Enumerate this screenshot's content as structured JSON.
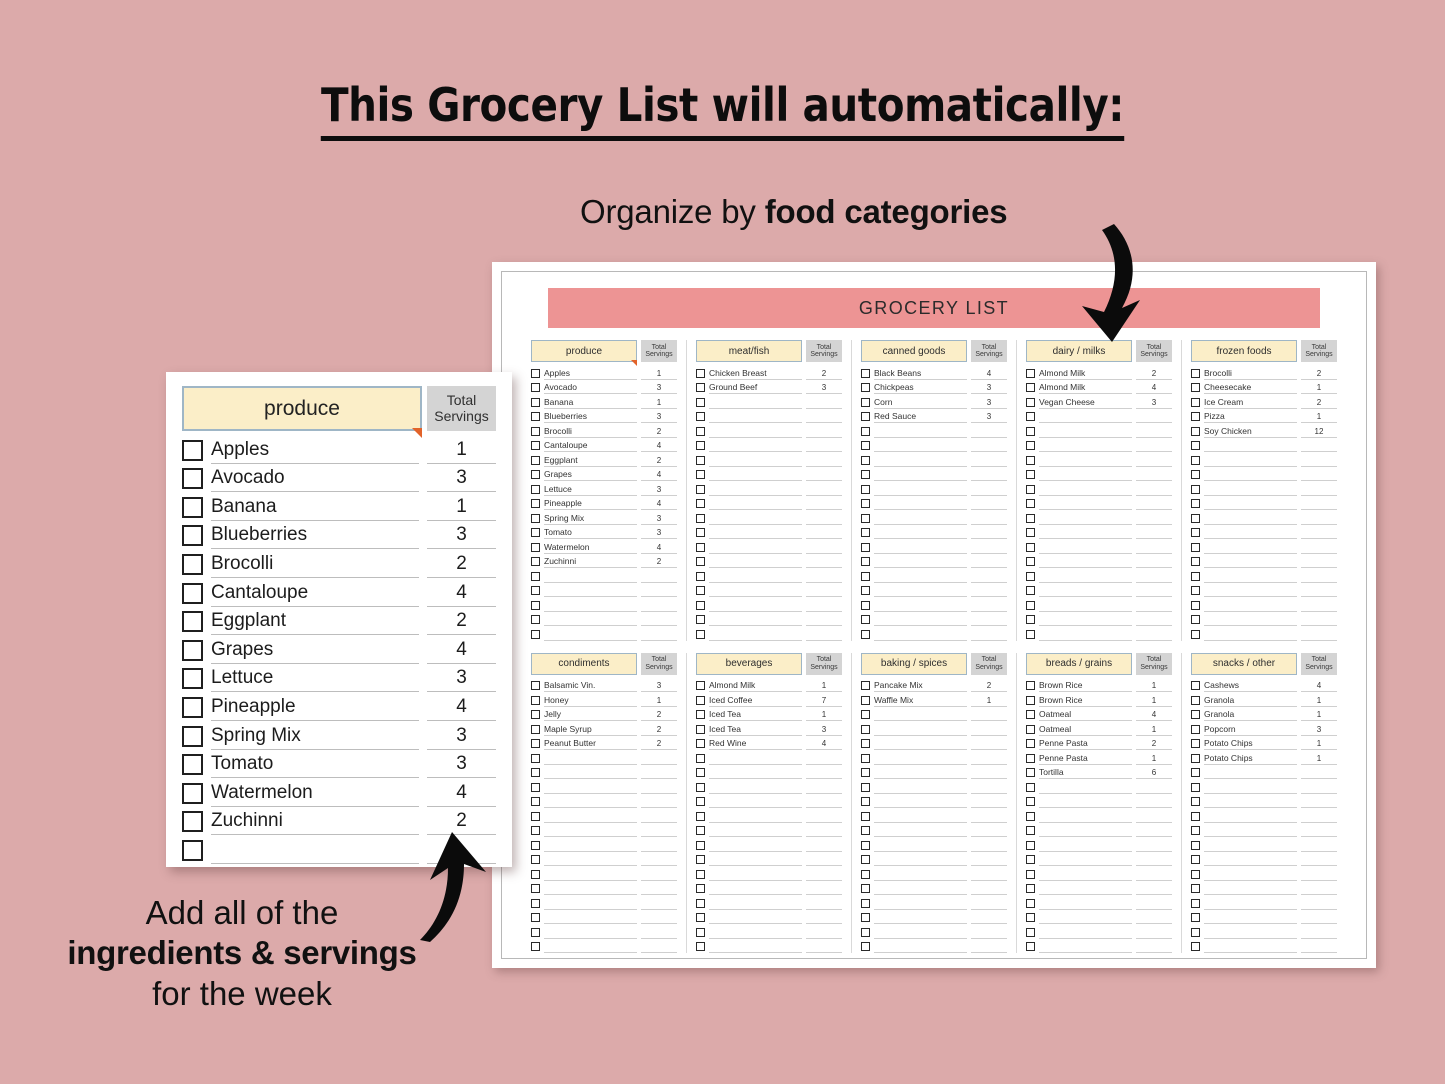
{
  "headline": "This Grocery List will automatically:",
  "subhead": {
    "prefix": "Organize by ",
    "emphasis": "food categories"
  },
  "caption": {
    "line1": "Add all of the",
    "line2": "ingredients & servings",
    "line3": "for the week"
  },
  "colors": {
    "background": "#dcaaaa",
    "title_bar": "#ed9494",
    "category_cell": "#fbeec8",
    "category_border": "#9fb6c6",
    "servings_header": "#d4d4d4",
    "marker_triangle": "#e2632a",
    "card": "#ffffff"
  },
  "sheet": {
    "title": "GROCERY LIST",
    "servings_header_line1": "Total",
    "servings_header_line2": "Servings",
    "rows_per_block": 19,
    "block_top": [
      {
        "category": "produce",
        "marked": true,
        "items": [
          {
            "name": "Apples",
            "qty": "1"
          },
          {
            "name": "Avocado",
            "qty": "3"
          },
          {
            "name": "Banana",
            "qty": "1"
          },
          {
            "name": "Blueberries",
            "qty": "3"
          },
          {
            "name": "Brocolli",
            "qty": "2"
          },
          {
            "name": "Cantaloupe",
            "qty": "4"
          },
          {
            "name": "Eggplant",
            "qty": "2"
          },
          {
            "name": "Grapes",
            "qty": "4"
          },
          {
            "name": "Lettuce",
            "qty": "3"
          },
          {
            "name": "Pineapple",
            "qty": "4"
          },
          {
            "name": "Spring Mix",
            "qty": "3"
          },
          {
            "name": "Tomato",
            "qty": "3"
          },
          {
            "name": "Watermelon",
            "qty": "4"
          },
          {
            "name": "Zuchinni",
            "qty": "2"
          }
        ]
      },
      {
        "category": "meat/fish",
        "marked": false,
        "items": [
          {
            "name": "Chicken Breast",
            "qty": "2"
          },
          {
            "name": "Ground Beef",
            "qty": "3"
          }
        ]
      },
      {
        "category": "canned goods",
        "marked": false,
        "items": [
          {
            "name": "Black Beans",
            "qty": "4"
          },
          {
            "name": "Chickpeas",
            "qty": "3"
          },
          {
            "name": "Corn",
            "qty": "3"
          },
          {
            "name": "Red Sauce",
            "qty": "3"
          }
        ]
      },
      {
        "category": "dairy / milks",
        "marked": false,
        "items": [
          {
            "name": "Almond Milk",
            "qty": "2"
          },
          {
            "name": "Almond Milk",
            "qty": "4"
          },
          {
            "name": "Vegan Cheese",
            "qty": "3"
          }
        ]
      },
      {
        "category": "frozen foods",
        "marked": false,
        "items": [
          {
            "name": "Brocolli",
            "qty": "2"
          },
          {
            "name": "Cheesecake",
            "qty": "1"
          },
          {
            "name": "Ice Cream",
            "qty": "2"
          },
          {
            "name": "Pizza",
            "qty": "1"
          },
          {
            "name": "Soy Chicken",
            "qty": "12"
          }
        ]
      }
    ],
    "block_bottom": [
      {
        "category": "condiments",
        "marked": false,
        "items": [
          {
            "name": "Balsamic Vin.",
            "qty": "3"
          },
          {
            "name": "Honey",
            "qty": "1"
          },
          {
            "name": "Jelly",
            "qty": "2"
          },
          {
            "name": "Maple Syrup",
            "qty": "2"
          },
          {
            "name": "Peanut Butter",
            "qty": "2"
          }
        ]
      },
      {
        "category": "beverages",
        "marked": false,
        "items": [
          {
            "name": "Almond Milk",
            "qty": "1"
          },
          {
            "name": "Iced Coffee",
            "qty": "7"
          },
          {
            "name": "Iced Tea",
            "qty": "1"
          },
          {
            "name": "Iced Tea",
            "qty": "3"
          },
          {
            "name": "Red Wine",
            "qty": "4"
          }
        ]
      },
      {
        "category": "baking / spices",
        "marked": false,
        "items": [
          {
            "name": "Pancake Mix",
            "qty": "2"
          },
          {
            "name": "Waffle Mix",
            "qty": "1"
          }
        ]
      },
      {
        "category": "breads / grains",
        "marked": false,
        "items": [
          {
            "name": "Brown Rice",
            "qty": "1"
          },
          {
            "name": "Brown Rice",
            "qty": "1"
          },
          {
            "name": "Oatmeal",
            "qty": "4"
          },
          {
            "name": "Oatmeal",
            "qty": "1"
          },
          {
            "name": "Penne Pasta",
            "qty": "2"
          },
          {
            "name": "Penne Pasta",
            "qty": "1"
          },
          {
            "name": "Tortilla",
            "qty": "6"
          }
        ]
      },
      {
        "category": "snacks / other",
        "marked": false,
        "items": [
          {
            "name": "Cashews",
            "qty": "4"
          },
          {
            "name": "Granola",
            "qty": "1"
          },
          {
            "name": "Granola",
            "qty": "1"
          },
          {
            "name": "Popcorn",
            "qty": "3"
          },
          {
            "name": "Potato Chips",
            "qty": "1"
          },
          {
            "name": "Potato Chips",
            "qty": "1"
          }
        ]
      }
    ]
  },
  "zoom_card": {
    "category": "produce",
    "servings_header_line1": "Total",
    "servings_header_line2": "Servings",
    "rows_total": 15,
    "items": [
      {
        "name": "Apples",
        "qty": "1"
      },
      {
        "name": "Avocado",
        "qty": "3"
      },
      {
        "name": "Banana",
        "qty": "1"
      },
      {
        "name": "Blueberries",
        "qty": "3"
      },
      {
        "name": "Brocolli",
        "qty": "2"
      },
      {
        "name": "Cantaloupe",
        "qty": "4"
      },
      {
        "name": "Eggplant",
        "qty": "2"
      },
      {
        "name": "Grapes",
        "qty": "4"
      },
      {
        "name": "Lettuce",
        "qty": "3"
      },
      {
        "name": "Pineapple",
        "qty": "4"
      },
      {
        "name": "Spring Mix",
        "qty": "3"
      },
      {
        "name": "Tomato",
        "qty": "3"
      },
      {
        "name": "Watermelon",
        "qty": "4"
      },
      {
        "name": "Zuchinni",
        "qty": "2"
      }
    ]
  }
}
